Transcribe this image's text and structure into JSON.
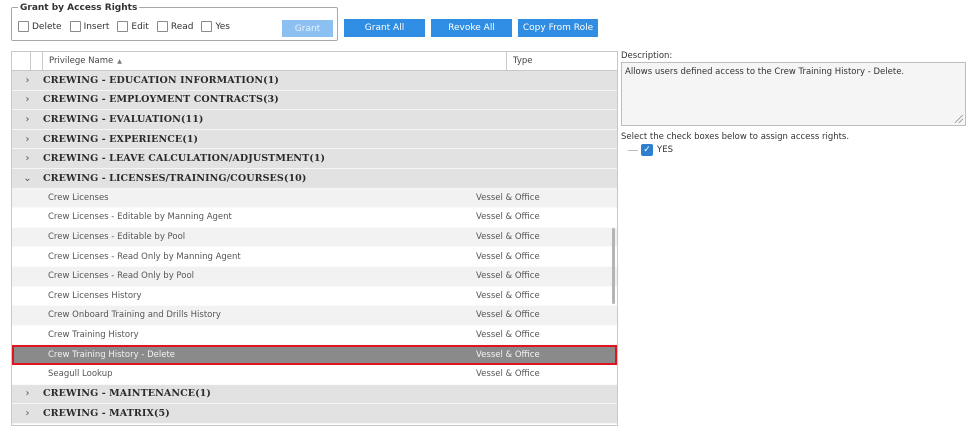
{
  "grant_box": {
    "title": "Grant by Access Rights",
    "checkboxes": [
      {
        "label": "Delete",
        "checked": false
      },
      {
        "label": "Insert",
        "checked": false
      },
      {
        "label": "Edit",
        "checked": false
      },
      {
        "label": "Read",
        "checked": false
      },
      {
        "label": "Yes",
        "checked": false
      }
    ],
    "grant_label": "Grant"
  },
  "toolbar": {
    "grant_all_label": "Grant All",
    "revoke_all_label": "Revoke All",
    "copy_from_role_label": "Copy From Role"
  },
  "grid": {
    "col_name": "Privilege Name",
    "col_type": "Type",
    "groups_before": [
      "CREWING - EDUCATION INFORMATION(1)",
      "CREWING - EMPLOYMENT CONTRACTS(3)",
      "CREWING - EVALUATION(11)",
      "CREWING - EXPERIENCE(1)",
      "CREWING - LEAVE CALCULATION/ADJUSTMENT(1)"
    ],
    "expanded_group": "CREWING - LICENSES/TRAINING/COURSES(10)",
    "items": [
      {
        "name": "Crew Licenses",
        "type": "Vessel & Office"
      },
      {
        "name": "Crew Licenses - Editable by Manning Agent",
        "type": "Vessel & Office"
      },
      {
        "name": "Crew Licenses - Editable by Pool",
        "type": "Vessel & Office"
      },
      {
        "name": "Crew Licenses - Read Only by Manning Agent",
        "type": "Vessel & Office"
      },
      {
        "name": "Crew Licenses - Read Only by Pool",
        "type": "Vessel & Office"
      },
      {
        "name": "Crew Licenses History",
        "type": "Vessel & Office"
      },
      {
        "name": "Crew Onboard Training and Drills History",
        "type": "Vessel & Office"
      },
      {
        "name": "Crew Training History",
        "type": "Vessel & Office"
      },
      {
        "name": "Crew Training History - Delete",
        "type": "Vessel & Office"
      },
      {
        "name": "Seagull Lookup",
        "type": "Vessel & Office"
      }
    ],
    "groups_after": [
      "CREWING - MAINTENANCE(1)",
      "CREWING - MATRIX(5)"
    ]
  },
  "description": {
    "title": "Description:",
    "text": "Allows users defined access to the Crew Training History - Delete."
  },
  "assign": {
    "text": "Select the check boxes below to assign access rights.",
    "option_label": "YES"
  },
  "colors": {
    "button": "#2f8de4",
    "selected_outline": "#e0141e",
    "selected_bg": "#8a8a8a"
  }
}
